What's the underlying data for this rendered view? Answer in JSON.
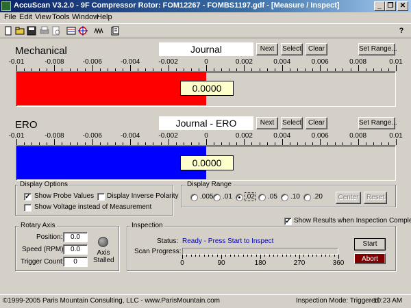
{
  "window": {
    "title": "AccuScan V3.2.0 - 9F Compressor Rotor: FOM12267 - FOMBS1197.gdf - [Measure / Inspect]",
    "minimize_glyph": "_",
    "restore_glyph": "❐",
    "close_glyph": "✕",
    "help_glyph": "?"
  },
  "menu": [
    "File",
    "Edit",
    "View",
    "Tools",
    "Window",
    "Help"
  ],
  "toolbar_icons": [
    "new-file-icon",
    "open-folder-icon",
    "save-icon",
    "print-icon",
    "print-preview-icon",
    "probe-icon",
    "target-icon",
    "waveform-icon",
    "report-icon"
  ],
  "scale_ticks": [
    "-0.01",
    "-0.008",
    "-0.006",
    "-0.004",
    "-0.002",
    "0",
    "0.002",
    "0.004",
    "0.006",
    "0.008",
    "0.01"
  ],
  "mechanical": {
    "label": "Mechanical",
    "probe_name": "Journal",
    "next_label": "Next",
    "select_label": "Select",
    "clear_label": "Clear",
    "set_range_label": "Set Range...",
    "value": "0.0000",
    "bar_fraction": -0.5,
    "bar_color": "#ff0000"
  },
  "ero": {
    "label": "ERO",
    "probe_name": "Journal - ERO",
    "next_label": "Next",
    "select_label": "Select",
    "clear_label": "Clear",
    "set_range_label": "Set Range...",
    "value": "0.0000",
    "bar_fraction": -0.5,
    "bar_color": "#0000ff"
  },
  "display_options": {
    "title": "Display Options",
    "show_probe_values": "Show Probe Values",
    "show_probe_values_checked": true,
    "display_inverse_polarity": "Display Inverse Polarity",
    "display_inverse_polarity_checked": false,
    "show_voltage": "Show Voltage instead of Measurement",
    "show_voltage_checked": false
  },
  "display_range": {
    "title": "Display Range",
    "options": [
      ".005",
      ".01",
      ".02",
      ".05",
      ".10",
      ".20"
    ],
    "selected": ".02",
    "center_label": "Center",
    "reset_label": "Reset"
  },
  "rotary_axis": {
    "title": "Rotary Axis",
    "position_label": "Position:",
    "position_value": "0.0",
    "speed_label": "Speed (RPM):",
    "speed_value": "0.0",
    "trigger_label": "Trigger Count:",
    "trigger_value": "0",
    "axis_status": "Axis Stalled"
  },
  "show_results": {
    "label": "Show Results when Inspection Completes",
    "checked": true
  },
  "inspection": {
    "title": "Inspection",
    "status_label": "Status:",
    "status_value": "Ready - Press Start to Inspect",
    "status_color": "#0000c0",
    "progress_label": "Scan Progress:",
    "progress_fraction": 0.0,
    "progress_ticks": [
      "0",
      "90",
      "180",
      "270",
      "360"
    ],
    "start_label": "Start",
    "abort_label": "Abort",
    "abort_color": "#800000"
  },
  "statusbar": {
    "copyright": "©1999-2005 Paris Mountain Consulting, LLC - www.ParisMountain.com",
    "mode": "Inspection Mode: Triggered",
    "time": "10:23 AM"
  }
}
